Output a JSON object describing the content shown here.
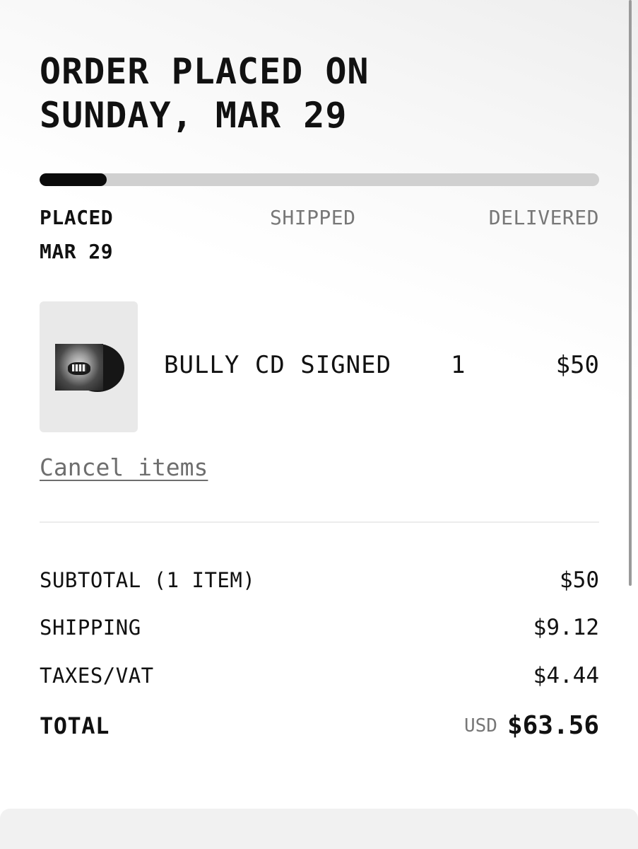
{
  "order": {
    "title_line1": "ORDER PLACED ON",
    "title_line2": "SUNDAY, MAR 29",
    "progress": {
      "fraction_complete": 0.12,
      "stages": [
        {
          "label": "PLACED",
          "date": "MAR 29",
          "active": true
        },
        {
          "label": "SHIPPED",
          "active": false
        },
        {
          "label": "DELIVERED",
          "active": false
        }
      ]
    }
  },
  "items": [
    {
      "name": "BULLY CD SIGNED",
      "quantity": "1",
      "price": "$50",
      "thumbnail_icon": "cd-album-cover-icon"
    }
  ],
  "actions": {
    "cancel_label": "Cancel items"
  },
  "summary": {
    "subtotal_label": "SUBTOTAL (1 ITEM)",
    "subtotal_value": "$50",
    "shipping_label": "SHIPPING",
    "shipping_value": "$9.12",
    "taxes_label": "TAXES/VAT",
    "taxes_value": "$4.44",
    "total_label": "TOTAL",
    "total_currency": "USD",
    "total_value": "$63.56"
  },
  "colors": {
    "progress_fill": "#0b0b0b",
    "progress_track": "#d0d0d0",
    "muted_text": "#777777",
    "link_text": "#6e6e6e"
  }
}
